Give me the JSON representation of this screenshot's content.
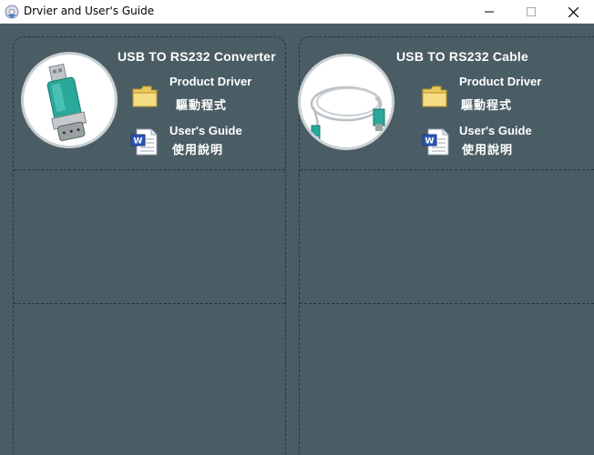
{
  "window": {
    "title": "Drvier and User's Guide",
    "app_icon": "disc-icon",
    "controls": [
      "minimize-icon",
      "maximize-icon",
      "close-icon"
    ]
  },
  "products": [
    {
      "heading": "USB  TO RS232  Converter",
      "image": "usb-serial-converter-image",
      "driver_label": "Product Driver",
      "driver_label_cn": "驅動程式",
      "driver_icon": "folder-icon",
      "guide_label": "User's Guide",
      "guide_label_cn": "使用說明",
      "guide_icon": "word-document-icon"
    },
    {
      "heading": "USB  TO RS232 Cable",
      "image": "usb-serial-cable-image",
      "driver_label": "Product Driver",
      "driver_label_cn": "驅動程式",
      "driver_icon": "folder-icon",
      "guide_label": "User's Guide",
      "guide_label_cn": "使用說明",
      "guide_icon": "word-document-icon"
    }
  ],
  "colors": {
    "background": "#4b5d64",
    "text": "#ffffff",
    "panel_border": "#26333a"
  }
}
